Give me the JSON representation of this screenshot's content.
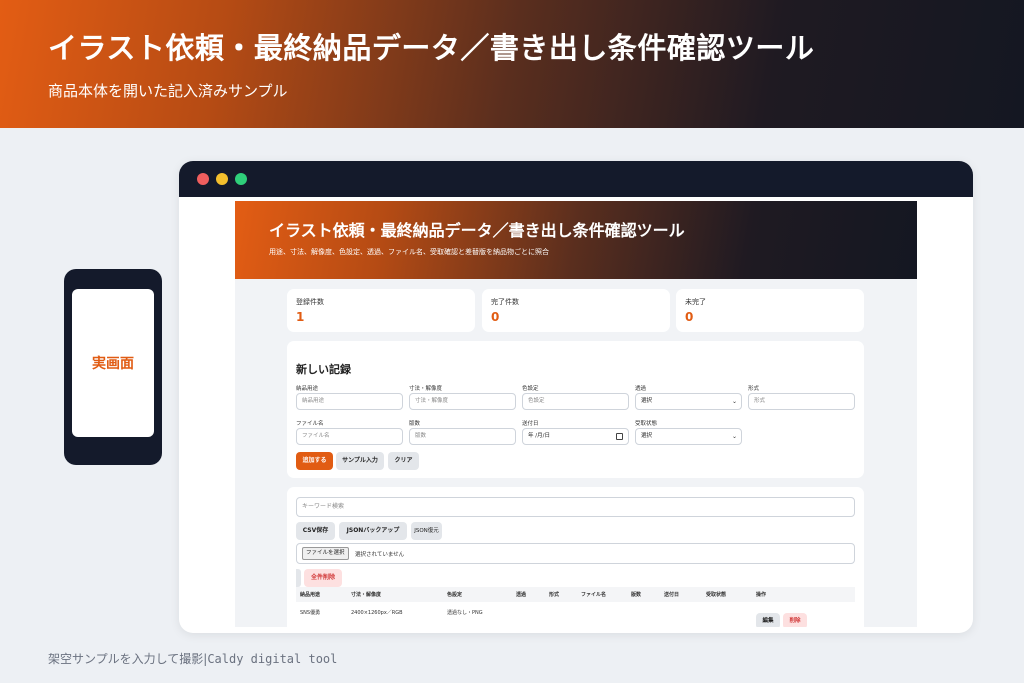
{
  "hero": {
    "title": "イラスト依頼・最終納品データ／書き出し条件確認ツール",
    "subtitle": "商品本体を開いた記入済みサンプル"
  },
  "phone": {
    "label": "実画面"
  },
  "app": {
    "title": "イラスト依頼・最終納品データ／書き出し条件確認ツール",
    "subtitle": "用途、寸法、解像度、色設定、透過、ファイル名、受取確認と差替版を納品物ごとに照合"
  },
  "stats": [
    {
      "label": "登録件数",
      "value": "1"
    },
    {
      "label": "完了件数",
      "value": "0"
    },
    {
      "label": "未完了",
      "value": "0"
    }
  ],
  "form": {
    "title": "新しい記録",
    "fields": {
      "usage": {
        "label": "納品用途",
        "placeholder": "納品用途"
      },
      "size": {
        "label": "寸法・解像度",
        "placeholder": "寸法・解像度"
      },
      "color": {
        "label": "色設定",
        "placeholder": "色設定"
      },
      "transparency": {
        "label": "透過",
        "value": "選択"
      },
      "format": {
        "label": "形式",
        "placeholder": "形式"
      },
      "filename": {
        "label": "ファイル名",
        "placeholder": "ファイル名"
      },
      "version": {
        "label": "版数",
        "placeholder": "版数"
      },
      "sent_date": {
        "label": "送付日",
        "value": "年 /月/日"
      },
      "receipt": {
        "label": "受取状態",
        "value": "選択"
      }
    },
    "buttons": {
      "add": "追加する",
      "sample": "サンプル入力",
      "clear": "クリア"
    }
  },
  "list": {
    "search_placeholder": "キーワード検索",
    "buttons": {
      "csv": "CSV保存",
      "json_backup": "JSONバックアップ",
      "json_restore": "JSON復元",
      "delete_all": "全件削除"
    },
    "file": {
      "button": "ファイルを選択",
      "status": "選択されていません"
    },
    "columns": [
      "納品用途",
      "寸法・解像度",
      "色設定",
      "透過",
      "形式",
      "ファイル名",
      "版数",
      "送付日",
      "受取状態",
      "操作"
    ],
    "rows": [
      {
        "usage": "SNS優勇",
        "size": "2400×1260px／RGB",
        "color": "透過なし・PNG",
        "edit": "編集",
        "delete": "削除"
      }
    ]
  },
  "caption": {
    "text": "架空サンプルを入力して撮影",
    "separator": "|",
    "brand": "Caldy digital tool"
  },
  "colors": {
    "accent": "#e15c13",
    "dark": "#141a2b",
    "danger": "#d23b3b"
  }
}
